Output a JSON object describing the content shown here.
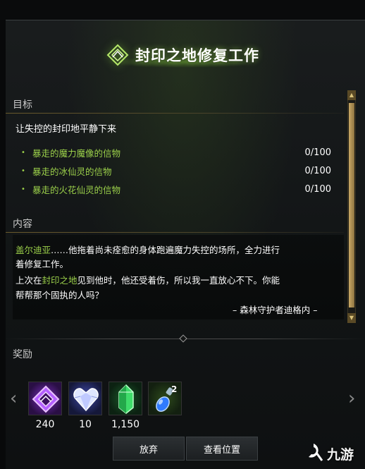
{
  "quest": {
    "title": "封印之地修复工作"
  },
  "objectives": {
    "header": "目标",
    "main": "让失控的封印地平静下来",
    "tasks": [
      {
        "bullet": "•",
        "name": "暴走的魔力魔像的信物",
        "count": "0/100"
      },
      {
        "bullet": "•",
        "name": "暴走的冰仙灵的信物",
        "count": "0/100"
      },
      {
        "bullet": "•",
        "name": "暴走的火花仙灵的信物",
        "count": "0/100"
      }
    ]
  },
  "content": {
    "header": "内容",
    "line1_hl": "盖尔迪亚",
    "line1_rest": "……他拖着尚未痊愈的身体跑遍魔力失控的场所，全力进行",
    "line2": "着修复工作。",
    "line3_pre": "上次在",
    "line3_hl": "封印之地",
    "line3_post": "见到他时，他还受着伤，所以我一直放心不下。你能",
    "line4": "帮帮那个固执的人吗？",
    "signature": "– 森林守护者迪格内 –"
  },
  "rewards": {
    "header": "奖励",
    "items": [
      {
        "icon": "purple-sigil-icon",
        "count": "240"
      },
      {
        "icon": "heart-crystal-icon",
        "count": "10"
      },
      {
        "icon": "green-crystal-icon",
        "count": "1,150"
      },
      {
        "icon": "blue-potion-icon",
        "count": "",
        "stack": "2"
      }
    ]
  },
  "buttons": {
    "abandon": "放弃",
    "view_location": "查看位置"
  },
  "watermark": {
    "text": "九游",
    "logo_letter": "9"
  },
  "colors": {
    "highlight": "#9bd04a",
    "accent_gold": "#c9a865"
  }
}
